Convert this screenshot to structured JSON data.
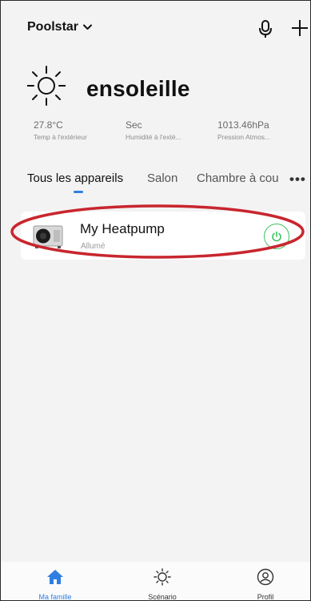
{
  "header": {
    "home_name": "Poolstar",
    "icons": {
      "dropdown": "chevron-down-icon",
      "mic": "microphone-icon",
      "add": "plus-icon"
    }
  },
  "weather": {
    "condition": "ensoleille",
    "icon": "sun-icon",
    "metrics": [
      {
        "value": "27.8°C",
        "label": "Temp à l'extérieur"
      },
      {
        "value": "Sec",
        "label": "Humidité à l'exté..."
      },
      {
        "value": "1013.46hPa",
        "label": "Pression Atmos..."
      }
    ]
  },
  "tabs": {
    "items": [
      {
        "label": "Tous les appareils",
        "active": true
      },
      {
        "label": "Salon",
        "active": false
      },
      {
        "label": "Chambre à cou",
        "active": false
      }
    ],
    "more_label": "•••"
  },
  "devices": [
    {
      "name": "My Heatpump",
      "status": "Allumé",
      "icon": "heatpump-icon",
      "power_icon": "power-icon",
      "power_on": true
    }
  ],
  "bottom_nav": {
    "items": [
      {
        "label": "Ma famille",
        "icon": "home-icon",
        "active": true
      },
      {
        "label": "Scénario",
        "icon": "sun-icon",
        "active": false
      },
      {
        "label": "Profil",
        "icon": "profile-icon",
        "active": false
      }
    ]
  },
  "colors": {
    "accent": "#2f7fe3",
    "power_on": "#3cc35e",
    "highlight_annotation": "#c8262e",
    "background": "#f3f3f3"
  }
}
